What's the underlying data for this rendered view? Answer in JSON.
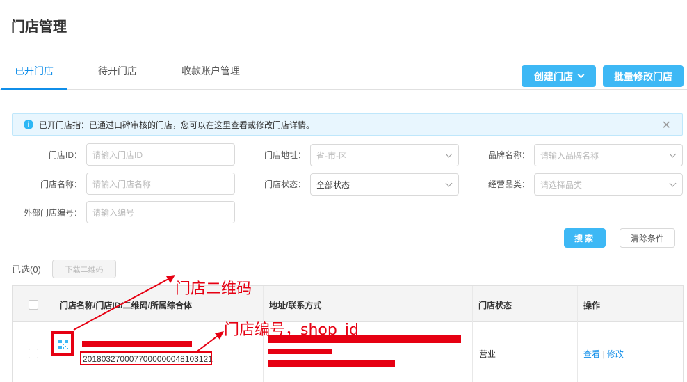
{
  "page": {
    "title": "门店管理"
  },
  "tabs": [
    {
      "label": "已开门店",
      "active": true
    },
    {
      "label": "待开门店",
      "active": false
    },
    {
      "label": "收款账户管理",
      "active": false
    }
  ],
  "actions": {
    "create_store": "创建门店",
    "batch_edit": "批量修改门店"
  },
  "alert": {
    "text": "已开门店指：已通过口碑审核的门店，您可以在这里查看或修改门店详情。"
  },
  "filters": {
    "store_id": {
      "label": "门店ID：",
      "placeholder": "请输入门店ID"
    },
    "store_address": {
      "label": "门店地址：",
      "placeholder": "省-市-区"
    },
    "brand_name": {
      "label": "品牌名称：",
      "placeholder": "请输入品牌名称"
    },
    "store_name": {
      "label": "门店名称：",
      "placeholder": "请输入门店名称"
    },
    "store_status": {
      "label": "门店状态：",
      "value": "全部状态"
    },
    "category": {
      "label": "经营品类：",
      "placeholder": "请选择品类"
    },
    "external_no": {
      "label": "外部门店编号：",
      "placeholder": "请输入编号"
    },
    "search_label": "搜索",
    "clear_label": "清除条件"
  },
  "selection": {
    "count_text": "已选(0)",
    "download_qr": "下载二维码"
  },
  "table": {
    "headers": [
      "门店名称/门店ID/二维码/所属综合体",
      "地址/联系方式",
      "门店状态",
      "操作"
    ],
    "rows": [
      {
        "store_id": "2018032700077000000048103121",
        "status": "营业",
        "action_view": "查看",
        "action_sep": "|",
        "action_edit": "修改"
      }
    ]
  },
  "annotations": {
    "qr_label": "门店二维码",
    "shop_id_label": "门店编号，shop_id"
  },
  "colors": {
    "accent": "#3db8f5",
    "link": "#108ee9",
    "annotation": "#e60012",
    "alert_bg": "#e8f6fe"
  }
}
